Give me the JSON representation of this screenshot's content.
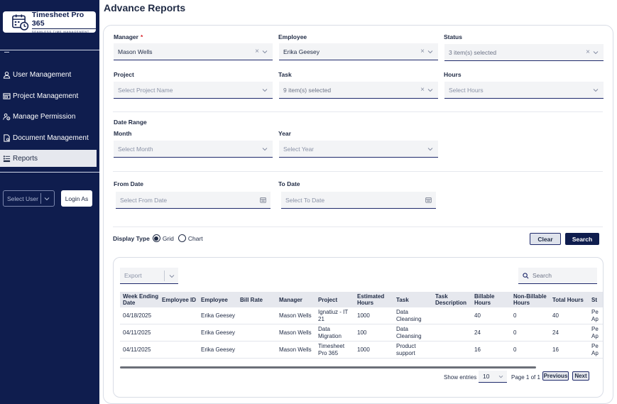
{
  "brand": {
    "title": "Timesheet Pro 365",
    "subtitle": "SEAMLESS TIME MANAGEMENT"
  },
  "sidebar": {
    "items": [
      {
        "label": "User Management",
        "icon": "user-icon"
      },
      {
        "label": "Project Management",
        "icon": "window-icon"
      },
      {
        "label": "Manage Permission",
        "icon": "permission-icon"
      },
      {
        "label": "Document Management",
        "icon": "document-icon"
      },
      {
        "label": "Reports",
        "icon": "report-icon",
        "active": true
      }
    ],
    "select_user_placeholder": "Select User",
    "login_as_label": "Login As"
  },
  "page": {
    "title": "Advance Reports"
  },
  "filters": {
    "manager": {
      "label": "Manager",
      "required": "*",
      "value": "Mason Wells"
    },
    "employee": {
      "label": "Employee",
      "value": "Erika Geesey"
    },
    "status": {
      "label": "Status",
      "value": "3 item(s) selected"
    },
    "project": {
      "label": "Project",
      "placeholder": "Select Project Name"
    },
    "task": {
      "label": "Task",
      "value": "9 item(s) selected"
    },
    "hours": {
      "label": "Hours",
      "placeholder": "Select Hours"
    },
    "date_range_label": "Date Range",
    "month": {
      "label": "Month",
      "placeholder": "Select Month"
    },
    "year": {
      "label": "Year",
      "placeholder": "Select Year"
    },
    "from_date": {
      "label": "From Date",
      "placeholder": "Select From Date"
    },
    "to_date": {
      "label": "To Date",
      "placeholder": "Select To Date"
    }
  },
  "display_type": {
    "label": "Display Type",
    "options": [
      "Grid",
      "Chart"
    ],
    "selected": "Grid"
  },
  "actions": {
    "clear_label": "Clear",
    "search_label": "Search"
  },
  "grid": {
    "export_placeholder": "Export",
    "search_placeholder": "Search",
    "columns": [
      "Week Ending Date",
      "Employee ID",
      "Employee",
      "Bill Rate",
      "Manager",
      "Project",
      "Estimated Hours",
      "Task",
      "Task Description",
      "Billable Hours",
      "Non-Billable Hours",
      "Total Hours",
      "St"
    ],
    "rows": [
      [
        "04/18/2025",
        "",
        "Erika Geesey",
        "",
        "Mason Wells",
        "Ignatiuz - IT 21",
        "1000",
        "Data Cleansing",
        "",
        "40",
        "0",
        "40",
        "Pe Ap"
      ],
      [
        "04/11/2025",
        "",
        "Erika Geesey",
        "",
        "Mason Wells",
        "Data Migration",
        "100",
        "Data Cleansing",
        "",
        "24",
        "0",
        "24",
        "Pe Ap"
      ],
      [
        "04/11/2025",
        "",
        "Erika Geesey",
        "",
        "Mason Wells",
        "Timesheet Pro 365",
        "1000",
        "Product support",
        "",
        "16",
        "0",
        "16",
        "Pe Ap"
      ]
    ],
    "show_entries_label": "Show entries",
    "entries_value": "10",
    "page_info": "Page 1 of 1",
    "previous_label": "Previous",
    "next_label": "Next"
  },
  "colors": {
    "sidebar_bg": "#0f1d4e",
    "accent": "#1f2a6b",
    "required": "#d9242b"
  }
}
